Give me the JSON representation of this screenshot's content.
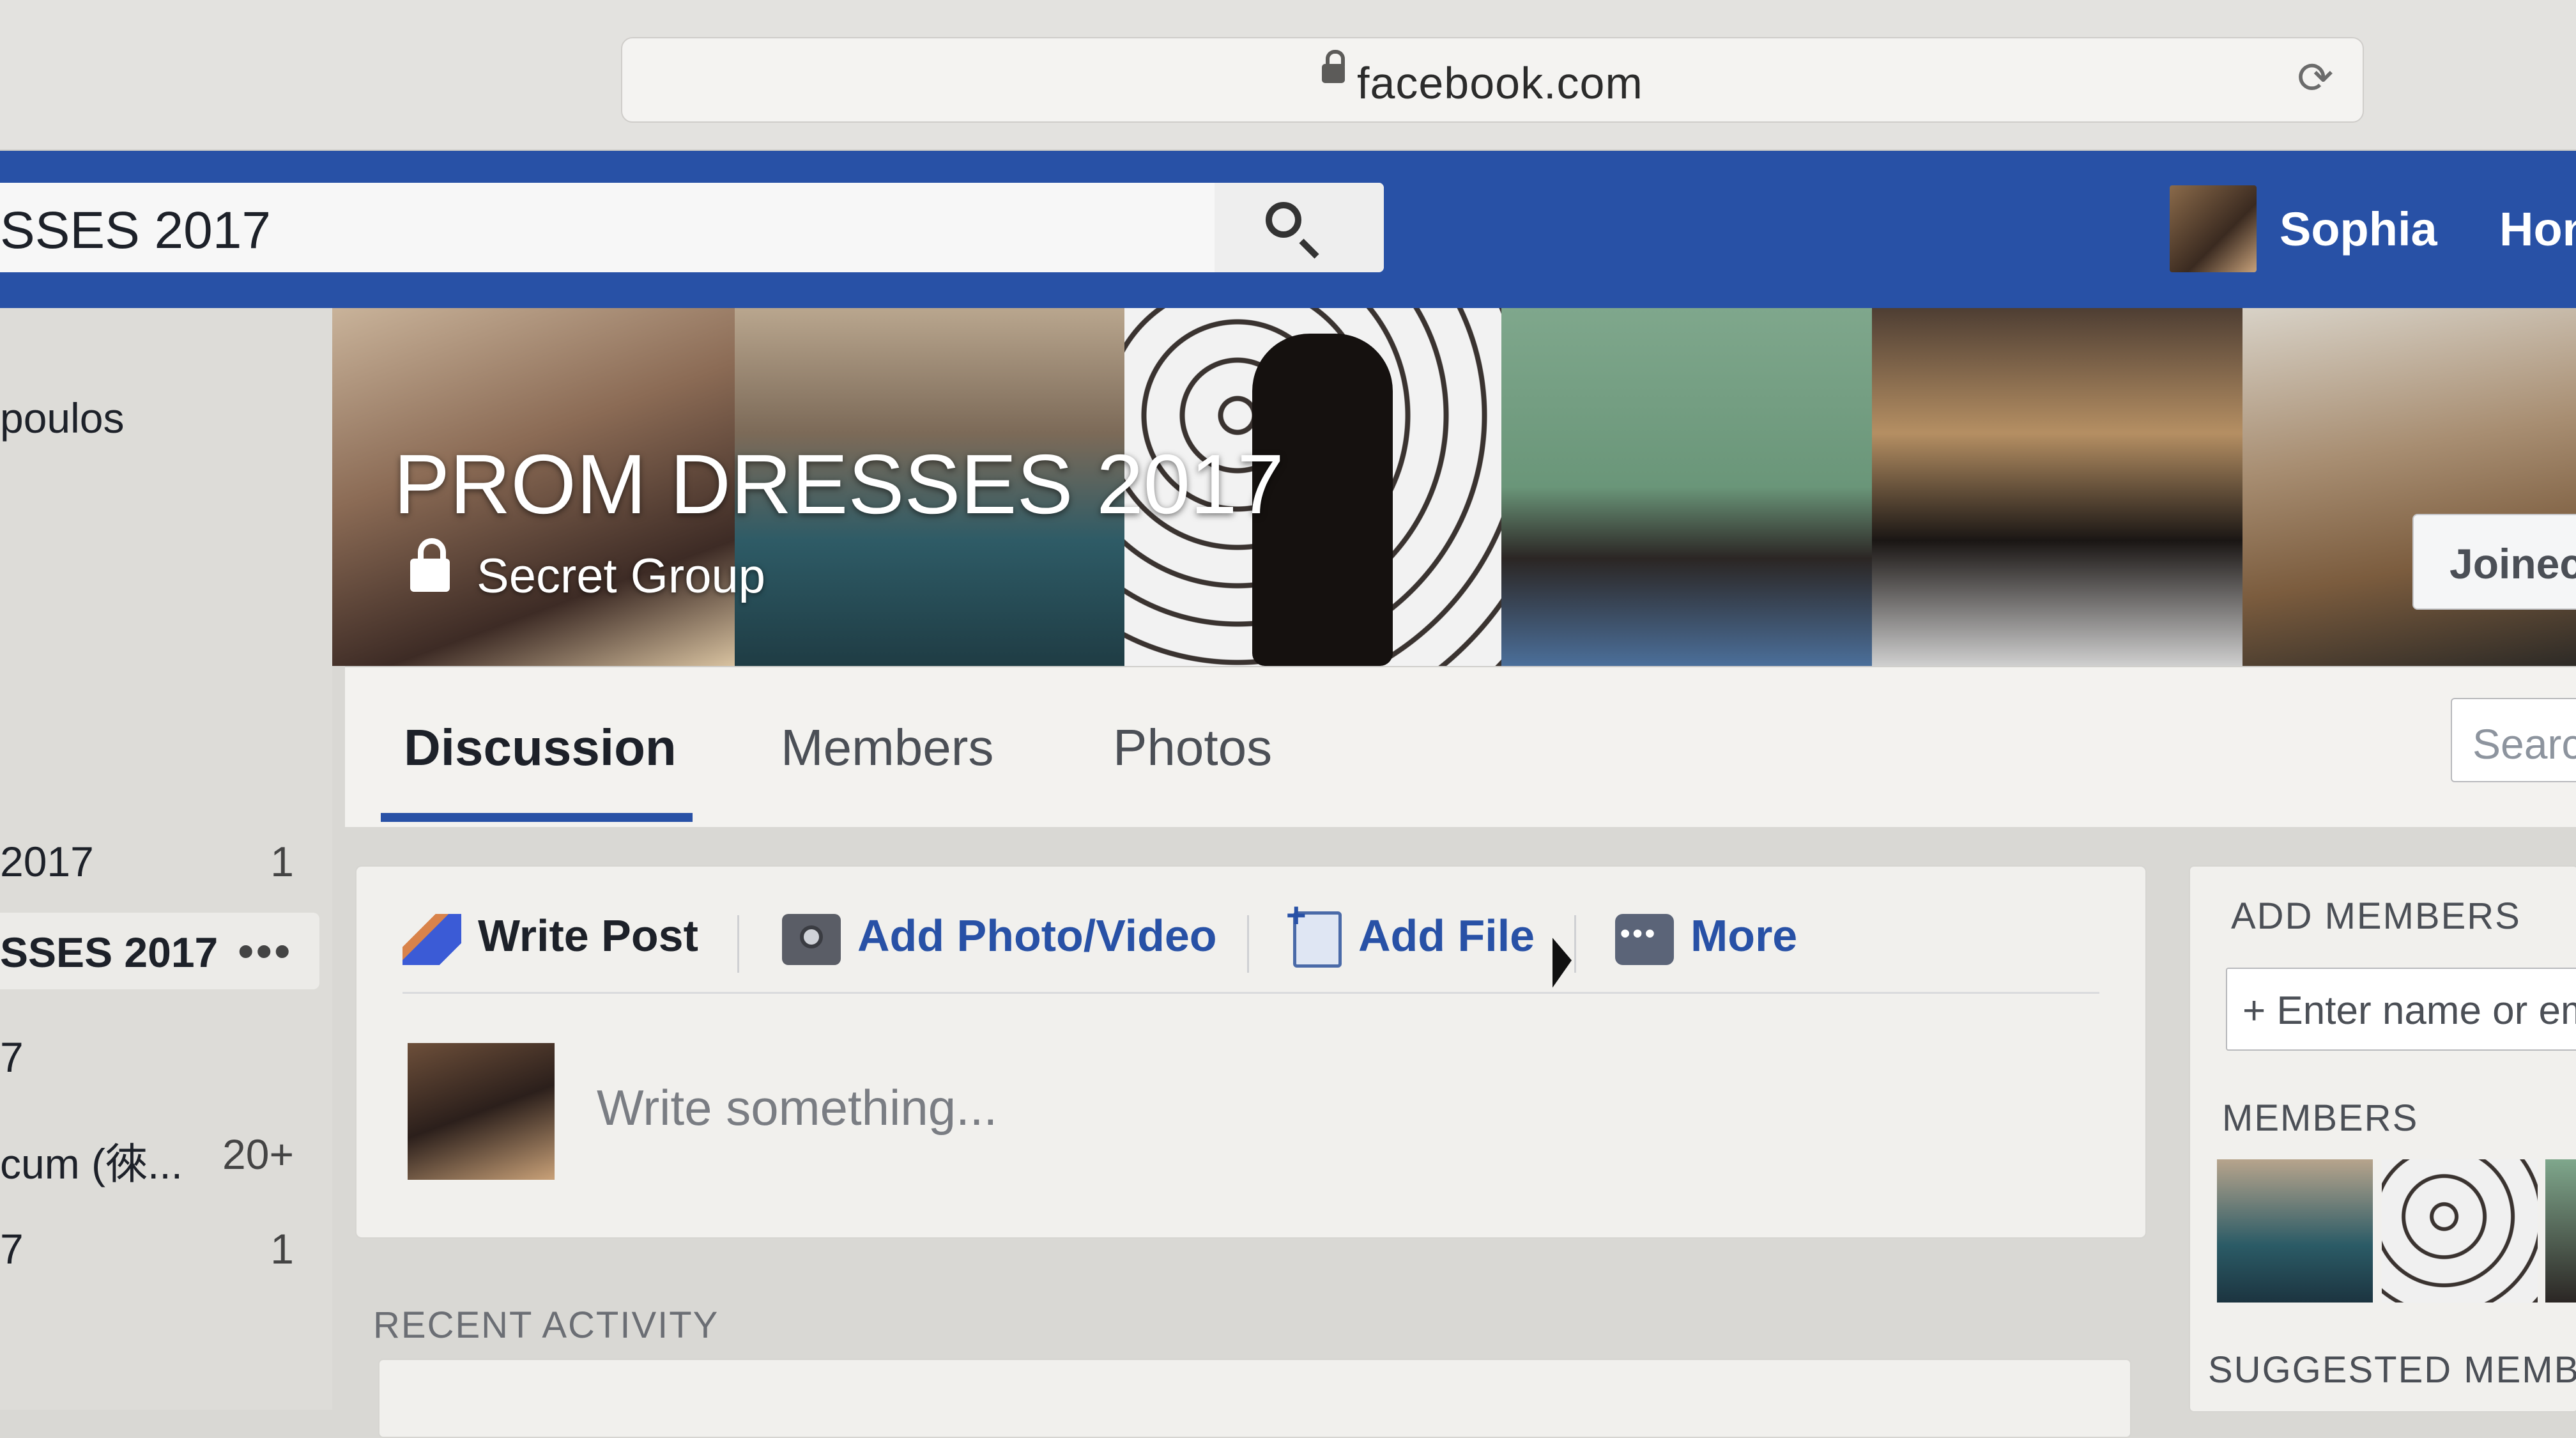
{
  "browser": {
    "url": "facebook.com"
  },
  "topbar": {
    "search_value": "SSES 2017",
    "profile_name": "Sophia",
    "home_label": "Hon"
  },
  "sidebar": {
    "items": [
      {
        "label": "poulos",
        "count": ""
      },
      {
        "label": "2017",
        "count": "1"
      },
      {
        "label": "SSES 2017",
        "count": ""
      },
      {
        "label": "7",
        "count": ""
      },
      {
        "label": "cum (徠...",
        "count": "20+"
      },
      {
        "label": "7",
        "count": "1"
      }
    ]
  },
  "group": {
    "title": "PROM DRESSES 2017",
    "privacy": "Secret Group",
    "joined_label": "Joinec"
  },
  "tabs": {
    "items": [
      "Discussion",
      "Members",
      "Photos"
    ],
    "search_placeholder": "Searc"
  },
  "composer": {
    "write_post": "Write Post",
    "add_photo": "Add Photo/Video",
    "add_file": "Add File",
    "more": "More",
    "placeholder": "Write something..."
  },
  "recent_activity": "RECENT ACTIVITY",
  "right": {
    "add_members_heading": "ADD MEMBERS",
    "add_members_placeholder": "+ Enter name or em",
    "members_heading": "MEMBERS",
    "suggested_heading": "SUGGESTED MEMBEI"
  },
  "colors": {
    "facebook_blue": "#2851a6",
    "link_blue": "#2851a6"
  }
}
